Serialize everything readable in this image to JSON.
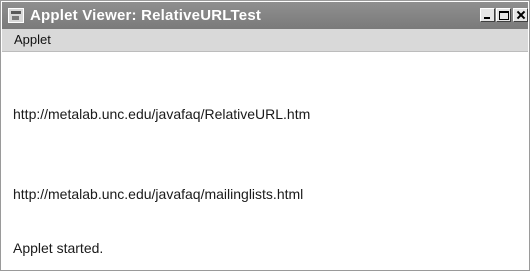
{
  "window": {
    "title": "Applet Viewer: RelativeURLTest"
  },
  "menubar": {
    "items": [
      {
        "label": "Applet"
      }
    ]
  },
  "content": {
    "lines": [
      "http://metalab.unc.edu/javafaq/RelativeURL.htm",
      "http://metalab.unc.edu/javafaq/mailinglists.html"
    ]
  },
  "status": {
    "text": "Applet started."
  },
  "icons": {
    "app": "java-applet-icon",
    "minimize": "minimize-icon",
    "maximize": "maximize-icon",
    "close": "close-icon"
  },
  "colors": {
    "titlebar": "#8a8a8a",
    "title_text": "#ffffff",
    "menubar": "#d9d9d9",
    "background": "#ffffff"
  }
}
